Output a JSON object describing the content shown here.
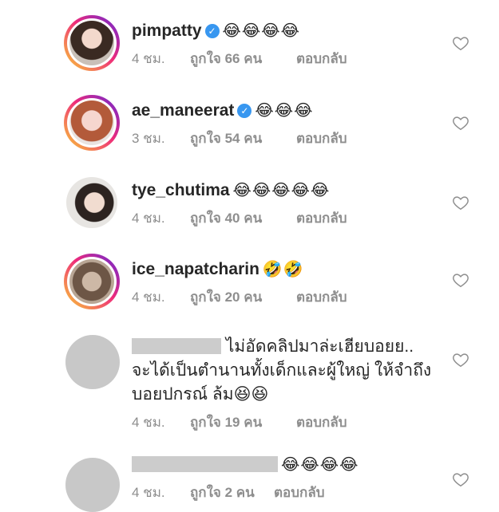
{
  "comments": [
    {
      "username": "pimpatty",
      "verified": true,
      "emoji": "😂😂😂😂",
      "time": "4 ชม.",
      "likes": "ถูกใจ 66 คน",
      "reply": "ตอบกลับ"
    },
    {
      "username": "ae_maneerat",
      "verified": true,
      "emoji": "😂😂😂",
      "time": "3 ชม.",
      "likes": "ถูกใจ 54 คน",
      "reply": "ตอบกลับ"
    },
    {
      "username": "tye_chutima",
      "verified": false,
      "emoji": "😂😂😂😂😂",
      "time": "4 ชม.",
      "likes": "ถูกใจ 40 คน",
      "reply": "ตอบกลับ"
    },
    {
      "username": "ice_napatcharin",
      "verified": false,
      "emoji": "🤣🤣",
      "time": "4 ชม.",
      "likes": "ถูกใจ 20 คน",
      "reply": "ตอบกลับ"
    },
    {
      "text_line1": "ไม่อัดคลิปมาล่ะเฮียบอยย..",
      "text_line2": "จะได้เป็นตำนานทั้งเด็กและผู้ใหญ่ ให้จำถึง",
      "text_line3": "บอยปกรณ์ ล้ม😆😆",
      "time": "4 ชม.",
      "likes": "ถูกใจ 19 คน",
      "reply": "ตอบกลับ"
    },
    {
      "emoji": "😂😂😂😂",
      "time": "4 ชม.",
      "likes": "ถูกใจ 2 คน",
      "reply": "ตอบกลับ"
    }
  ],
  "colors": {
    "primary_text": "#262626",
    "secondary_text": "#8e8e8e",
    "verified": "#3897f0",
    "redaction": "#cccccc"
  },
  "icons": {
    "like": "heart-outline-icon",
    "verified": "verified-badge-icon"
  }
}
